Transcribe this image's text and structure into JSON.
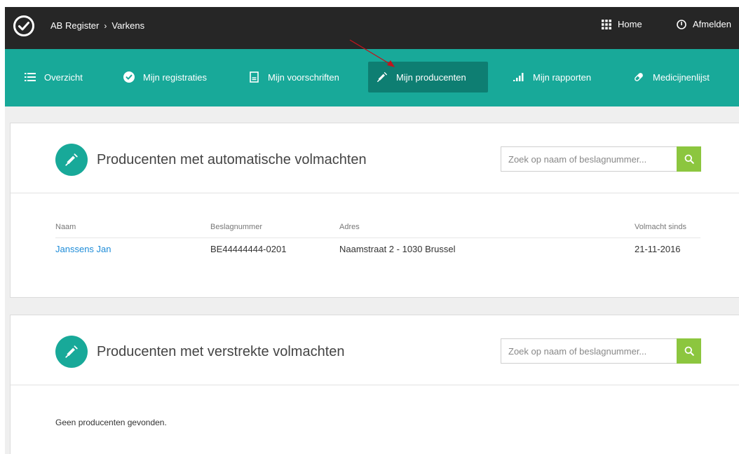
{
  "topbar": {
    "breadcrumb": [
      "AB Register",
      "Varkens"
    ],
    "breadcrumb_separator": "›",
    "home_label": "Home",
    "logout_label": "Afmelden",
    "background": "#262626"
  },
  "nav": {
    "background": "#18a999",
    "active_background": "#0e7e72",
    "items": [
      {
        "label": "Overzicht",
        "icon": "list-icon"
      },
      {
        "label": "Mijn registraties",
        "icon": "check-circle-icon"
      },
      {
        "label": "Mijn voorschriften",
        "icon": "document-icon"
      },
      {
        "label": "Mijn producenten",
        "icon": "syringe-icon",
        "active": true
      },
      {
        "label": "Mijn rapporten",
        "icon": "bar-chart-icon"
      },
      {
        "label": "Medicijnenlijst",
        "icon": "pill-icon"
      }
    ]
  },
  "section_automatic": {
    "title": "Producenten met automatische volmachten",
    "search_placeholder": "Zoek op naam of beslagnummer...",
    "columns": [
      "Naam",
      "Beslagnummer",
      "Adres",
      "Volmacht sinds"
    ],
    "rows": [
      {
        "naam": "Janssens Jan",
        "beslagnummer": "BE44444444-0201",
        "adres": "Naamstraat 2 - 1030 Brussel",
        "volmacht_sinds": "21-11-2016"
      }
    ]
  },
  "section_granted": {
    "title": "Producenten met verstrekte volmachten",
    "search_placeholder": "Zoek op naam of beslagnummer...",
    "empty_message": "Geen producenten gevonden."
  },
  "accent_green": "#8cc63f",
  "link_color": "#1e8cd8",
  "annotation_arrow_color": "#c0141c"
}
